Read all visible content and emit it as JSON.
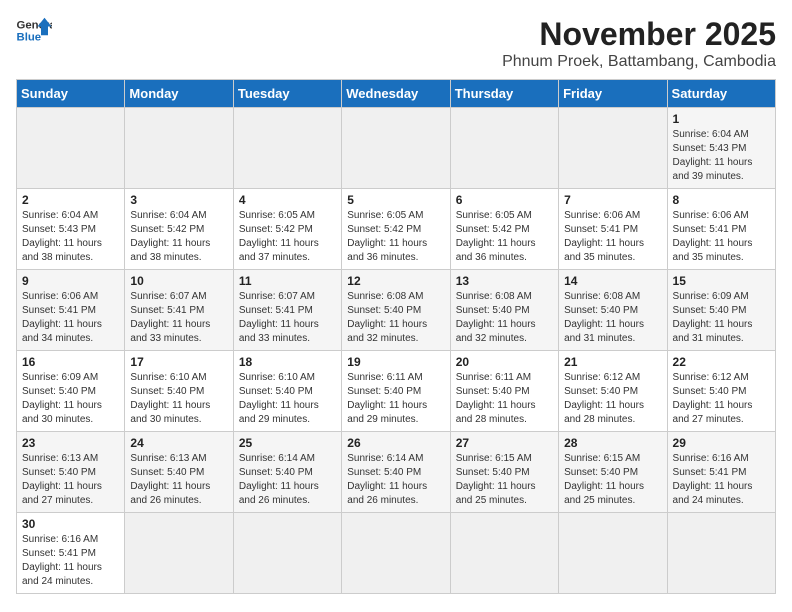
{
  "header": {
    "logo_line1": "General",
    "logo_line2": "Blue",
    "title": "November 2025",
    "subtitle": "Phnum Proek, Battambang, Cambodia"
  },
  "days_of_week": [
    "Sunday",
    "Monday",
    "Tuesday",
    "Wednesday",
    "Thursday",
    "Friday",
    "Saturday"
  ],
  "weeks": [
    [
      {
        "day": "",
        "info": ""
      },
      {
        "day": "",
        "info": ""
      },
      {
        "day": "",
        "info": ""
      },
      {
        "day": "",
        "info": ""
      },
      {
        "day": "",
        "info": ""
      },
      {
        "day": "",
        "info": ""
      },
      {
        "day": "1",
        "info": "Sunrise: 6:04 AM\nSunset: 5:43 PM\nDaylight: 11 hours\nand 39 minutes."
      }
    ],
    [
      {
        "day": "2",
        "info": "Sunrise: 6:04 AM\nSunset: 5:43 PM\nDaylight: 11 hours\nand 38 minutes."
      },
      {
        "day": "3",
        "info": "Sunrise: 6:04 AM\nSunset: 5:42 PM\nDaylight: 11 hours\nand 38 minutes."
      },
      {
        "day": "4",
        "info": "Sunrise: 6:05 AM\nSunset: 5:42 PM\nDaylight: 11 hours\nand 37 minutes."
      },
      {
        "day": "5",
        "info": "Sunrise: 6:05 AM\nSunset: 5:42 PM\nDaylight: 11 hours\nand 36 minutes."
      },
      {
        "day": "6",
        "info": "Sunrise: 6:05 AM\nSunset: 5:42 PM\nDaylight: 11 hours\nand 36 minutes."
      },
      {
        "day": "7",
        "info": "Sunrise: 6:06 AM\nSunset: 5:41 PM\nDaylight: 11 hours\nand 35 minutes."
      },
      {
        "day": "8",
        "info": "Sunrise: 6:06 AM\nSunset: 5:41 PM\nDaylight: 11 hours\nand 35 minutes."
      }
    ],
    [
      {
        "day": "9",
        "info": "Sunrise: 6:06 AM\nSunset: 5:41 PM\nDaylight: 11 hours\nand 34 minutes."
      },
      {
        "day": "10",
        "info": "Sunrise: 6:07 AM\nSunset: 5:41 PM\nDaylight: 11 hours\nand 33 minutes."
      },
      {
        "day": "11",
        "info": "Sunrise: 6:07 AM\nSunset: 5:41 PM\nDaylight: 11 hours\nand 33 minutes."
      },
      {
        "day": "12",
        "info": "Sunrise: 6:08 AM\nSunset: 5:40 PM\nDaylight: 11 hours\nand 32 minutes."
      },
      {
        "day": "13",
        "info": "Sunrise: 6:08 AM\nSunset: 5:40 PM\nDaylight: 11 hours\nand 32 minutes."
      },
      {
        "day": "14",
        "info": "Sunrise: 6:08 AM\nSunset: 5:40 PM\nDaylight: 11 hours\nand 31 minutes."
      },
      {
        "day": "15",
        "info": "Sunrise: 6:09 AM\nSunset: 5:40 PM\nDaylight: 11 hours\nand 31 minutes."
      }
    ],
    [
      {
        "day": "16",
        "info": "Sunrise: 6:09 AM\nSunset: 5:40 PM\nDaylight: 11 hours\nand 30 minutes."
      },
      {
        "day": "17",
        "info": "Sunrise: 6:10 AM\nSunset: 5:40 PM\nDaylight: 11 hours\nand 30 minutes."
      },
      {
        "day": "18",
        "info": "Sunrise: 6:10 AM\nSunset: 5:40 PM\nDaylight: 11 hours\nand 29 minutes."
      },
      {
        "day": "19",
        "info": "Sunrise: 6:11 AM\nSunset: 5:40 PM\nDaylight: 11 hours\nand 29 minutes."
      },
      {
        "day": "20",
        "info": "Sunrise: 6:11 AM\nSunset: 5:40 PM\nDaylight: 11 hours\nand 28 minutes."
      },
      {
        "day": "21",
        "info": "Sunrise: 6:12 AM\nSunset: 5:40 PM\nDaylight: 11 hours\nand 28 minutes."
      },
      {
        "day": "22",
        "info": "Sunrise: 6:12 AM\nSunset: 5:40 PM\nDaylight: 11 hours\nand 27 minutes."
      }
    ],
    [
      {
        "day": "23",
        "info": "Sunrise: 6:13 AM\nSunset: 5:40 PM\nDaylight: 11 hours\nand 27 minutes."
      },
      {
        "day": "24",
        "info": "Sunrise: 6:13 AM\nSunset: 5:40 PM\nDaylight: 11 hours\nand 26 minutes."
      },
      {
        "day": "25",
        "info": "Sunrise: 6:14 AM\nSunset: 5:40 PM\nDaylight: 11 hours\nand 26 minutes."
      },
      {
        "day": "26",
        "info": "Sunrise: 6:14 AM\nSunset: 5:40 PM\nDaylight: 11 hours\nand 26 minutes."
      },
      {
        "day": "27",
        "info": "Sunrise: 6:15 AM\nSunset: 5:40 PM\nDaylight: 11 hours\nand 25 minutes."
      },
      {
        "day": "28",
        "info": "Sunrise: 6:15 AM\nSunset: 5:40 PM\nDaylight: 11 hours\nand 25 minutes."
      },
      {
        "day": "29",
        "info": "Sunrise: 6:16 AM\nSunset: 5:41 PM\nDaylight: 11 hours\nand 24 minutes."
      }
    ],
    [
      {
        "day": "30",
        "info": "Sunrise: 6:16 AM\nSunset: 5:41 PM\nDaylight: 11 hours\nand 24 minutes."
      },
      {
        "day": "",
        "info": ""
      },
      {
        "day": "",
        "info": ""
      },
      {
        "day": "",
        "info": ""
      },
      {
        "day": "",
        "info": ""
      },
      {
        "day": "",
        "info": ""
      },
      {
        "day": "",
        "info": ""
      }
    ]
  ]
}
